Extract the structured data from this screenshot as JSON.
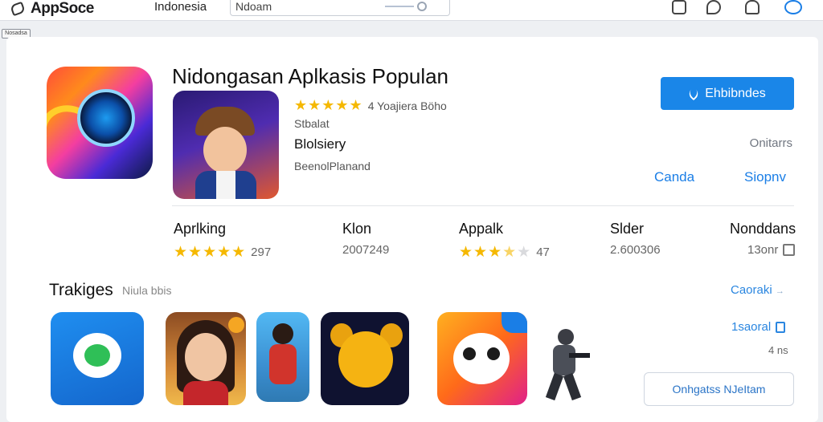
{
  "topbar": {
    "logo_text": "AppSoce",
    "region": "Indonesia",
    "search_value": "Ndoam"
  },
  "tiny_tag": "Nosadsa",
  "featured": {
    "heading": "Nidongasan Aplkasis Populan",
    "rating_stars": 5,
    "rating_text": "4 Yoajiera Böho",
    "meta_1": "Stbalat",
    "meta_2": "Blolsiery",
    "meta_3": "BeenolPlanand",
    "primary_button": "Ehbibndes",
    "right_meta": "Onitarrs",
    "link_a": "Canda",
    "link_b": "Siopnv"
  },
  "stats": [
    {
      "title": "Aprlking",
      "sub": "297",
      "stars": 5
    },
    {
      "title": "Klon",
      "sub": "2007249"
    },
    {
      "title": "Appalk",
      "sub": "47",
      "stars": 3.5
    },
    {
      "title": "Slder",
      "sub": "2.600306"
    },
    {
      "title": "Nonddans",
      "sub": "13onr"
    }
  ],
  "section": {
    "title": "Trakiges",
    "subtitle": "Niula bbis",
    "link": "Caoraki"
  },
  "side_panel": {
    "label": "1saoral",
    "size": "4 ns",
    "button": "Onhgatss NJeItam"
  },
  "colors": {
    "accent": "#1a86e8",
    "star": "#f5b800"
  }
}
